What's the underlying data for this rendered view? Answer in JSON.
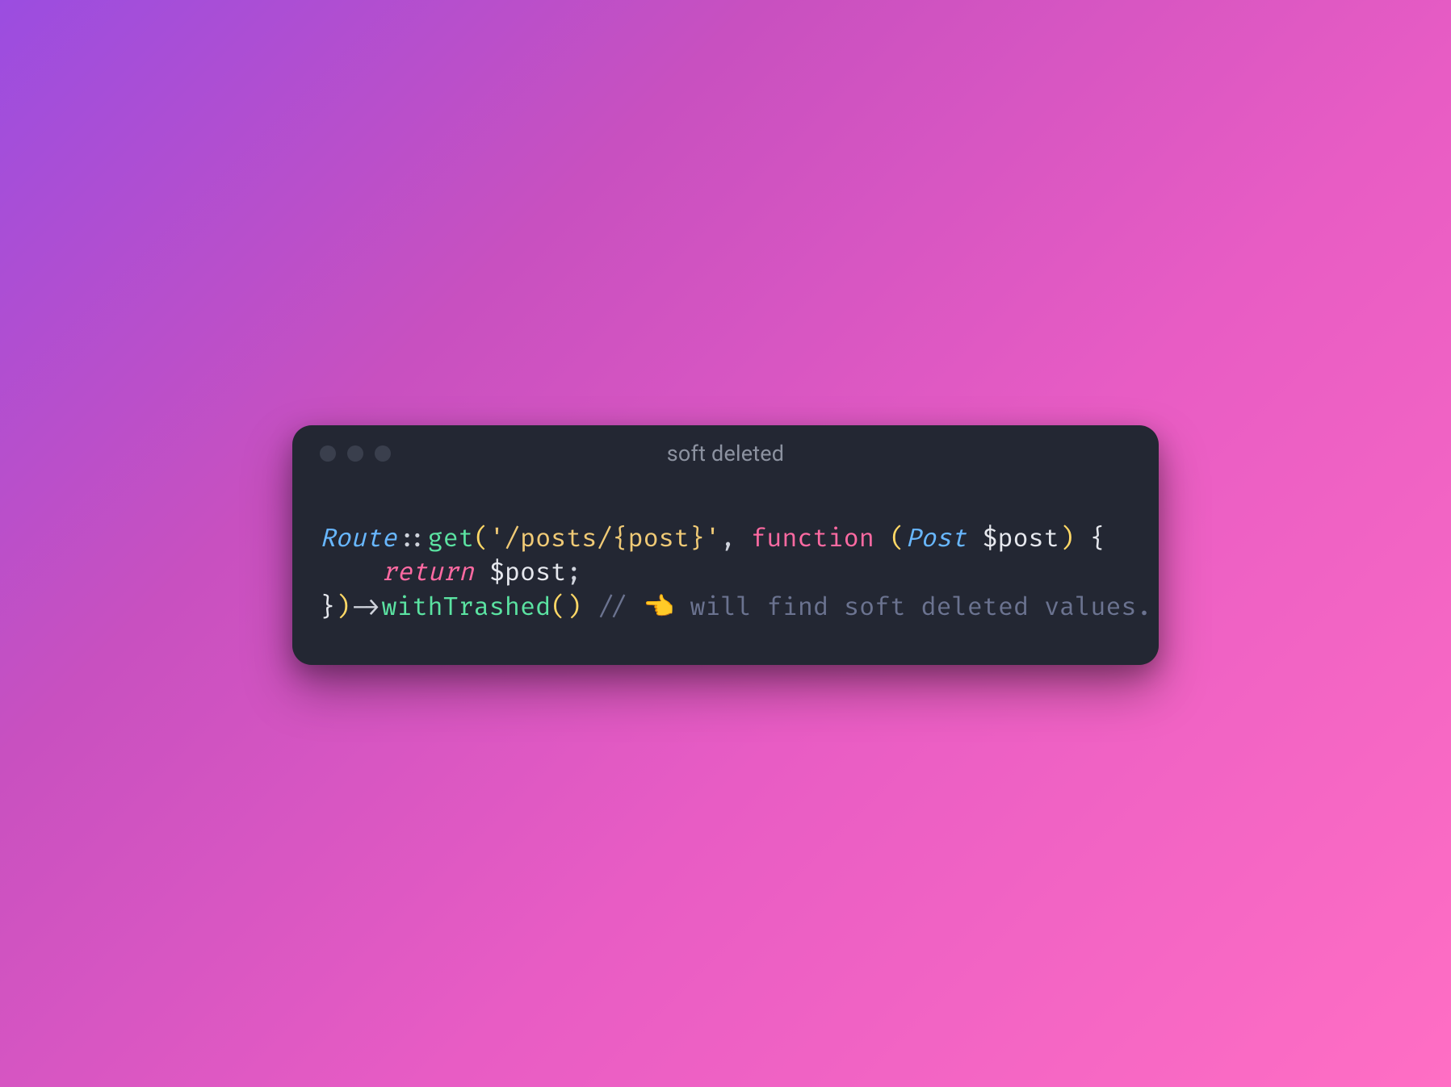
{
  "window": {
    "title": "soft deleted"
  },
  "code": {
    "line1": {
      "class": "Route",
      "scope": "::",
      "func": "get",
      "lparen": "(",
      "string": "'/posts/{post}'",
      "comma": ", ",
      "keyword_fn": "function",
      "space1": " ",
      "lparen2": "(",
      "type": "Post",
      "space2": " ",
      "var": "$post",
      "rparen2": ")",
      "space3": " ",
      "lbrace": "{"
    },
    "line2": {
      "indent": "    ",
      "keyword_ret": "return",
      "space": " ",
      "var": "$post",
      "semi": ";"
    },
    "line3": {
      "rbrace": "}",
      "rparen": ")",
      "arrow": "->",
      "func": "withTrashed",
      "lparen": "(",
      "rparen2": ")",
      "space": " ",
      "comment_slashes": "// ",
      "emoji": "👈",
      "comment_text": " will find soft deleted values."
    }
  }
}
